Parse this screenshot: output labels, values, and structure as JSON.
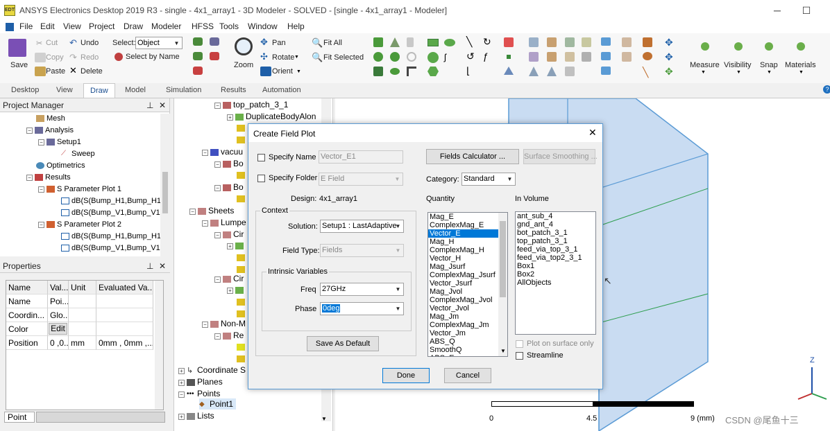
{
  "title": "ANSYS Electronics Desktop 2019 R3 - single - 4x1_array1 - 3D Modeler - SOLVED - [single - 4x1_array1 - Modeler]",
  "app_icon_text": "EDT",
  "menu": [
    "File",
    "Edit",
    "View",
    "Project",
    "Draw",
    "Modeler",
    "HFSS",
    "Tools",
    "Window",
    "Help"
  ],
  "ribbon": {
    "save": "Save",
    "cut": "Cut",
    "copy": "Copy",
    "paste": "Paste",
    "undo": "Undo",
    "redo": "Redo",
    "delete": "Delete",
    "select_label": "Select:",
    "select_value": "Object",
    "select_by_name": "Select by Name",
    "zoom": "Zoom",
    "pan": "Pan",
    "rotate": "Rotate",
    "orient": "Orient",
    "fit_all": "Fit All",
    "fit_selected": "Fit Selected",
    "measure": "Measure",
    "visibility": "Visibility",
    "snap": "Snap",
    "materials": "Materials"
  },
  "tabs": [
    "Desktop",
    "View",
    "Draw",
    "Model",
    "Simulation",
    "Results",
    "Automation"
  ],
  "active_tab": "Draw",
  "project_manager": {
    "title": "Project Manager",
    "items": [
      "Mesh",
      "Analysis",
      "Setup1",
      "Sweep",
      "Optimetrics",
      "Results",
      "S Parameter Plot 1",
      "dB(S(Bump_H1,Bump_H1))",
      "dB(S(Bump_V1,Bump_V1))",
      "S Parameter Plot 2",
      "dB(S(Bump_H1,Bump_H1))",
      "dB(S(Bump_V1,Bump_V1))"
    ]
  },
  "properties": {
    "title": "Properties",
    "headers": [
      "Name",
      "Val...",
      "Unit",
      "Evaluated Va..."
    ],
    "rows": [
      [
        "Name",
        "Poi...",
        "",
        ""
      ],
      [
        "Coordin...",
        "Glo...",
        "",
        ""
      ],
      [
        "Color",
        "Edit",
        "",
        ""
      ],
      [
        "Position",
        "0 ,0...",
        "mm",
        "0mm , 0mm ,..."
      ]
    ],
    "footer_tab": "Point"
  },
  "model_tree": [
    "top_patch_3_1",
    "DuplicateBodyAlon",
    "vacuu",
    "Bo",
    "Bo",
    "Sheets",
    "Lumpe",
    "Cir",
    "Cir",
    "Non-M",
    "Re",
    "Coordinate S",
    "Planes",
    "Points",
    "Point1",
    "Lists"
  ],
  "dialog": {
    "title": "Create Field Plot",
    "specify_name_label": "Specify Name",
    "specify_name_value": "Vector_E1",
    "specify_folder_label": "Specify Folder",
    "specify_folder_value": "E Field",
    "design_label": "Design:",
    "design_value": "4x1_array1",
    "context_label": "Context",
    "solution_label": "Solution:",
    "solution_value": "Setup1 : LastAdaptive",
    "field_type_label": "Field Type:",
    "field_type_value": "Fields",
    "intrinsic_label": "Intrinsic Variables",
    "freq_label": "Freq",
    "freq_value": "27GHz",
    "phase_label": "Phase",
    "phase_value": "0deg",
    "save_default": "Save As Default",
    "fields_calc": "Fields Calculator ...",
    "surface_smoothing": "Surface Smoothing ...",
    "category_label": "Category:",
    "category_value": "Standard",
    "quantity_label": "Quantity",
    "quantities": [
      "Mag_E",
      "ComplexMag_E",
      "Vector_E",
      "Mag_H",
      "ComplexMag_H",
      "Vector_H",
      "Mag_Jsurf",
      "ComplexMag_Jsurf",
      "Vector_Jsurf",
      "Mag_Jvol",
      "ComplexMag_Jvol",
      "Vector_Jvol",
      "Mag_Jm",
      "ComplexMag_Jm",
      "Vector_Jm",
      "ABS_Q",
      "SmoothQ",
      "ABS_Err"
    ],
    "selected_quantity": "Vector_E",
    "in_volume_label": "In Volume",
    "volumes": [
      "ant_sub_4",
      "gnd_ant_4",
      "bot_patch_3_1",
      "top_patch_3_1",
      "feed_via_top_3_1",
      "feed_via_top2_3_1",
      "Box1",
      "Box2",
      "AllObjects"
    ],
    "plot_on_surface": "Plot on surface only",
    "streamline": "Streamline",
    "done": "Done",
    "cancel": "Cancel"
  },
  "viewport": {
    "scale_labels": [
      "0",
      "4.5",
      "9 (mm)"
    ],
    "axis_z": "Z",
    "watermark": "CSDN @尾鱼十三"
  },
  "colors": {
    "accent": "#0078d7",
    "model_face": "#c9dcf2",
    "model_edge": "#5b9bd5",
    "green_line": "#2e9e4f"
  }
}
